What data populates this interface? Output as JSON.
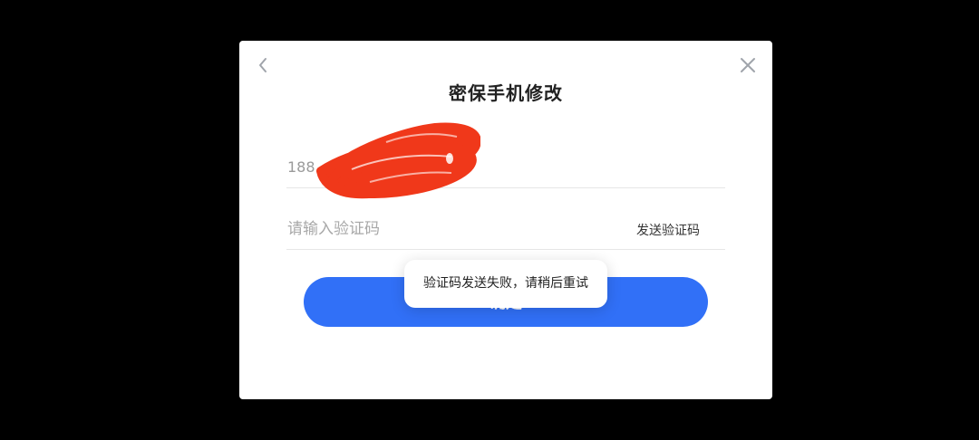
{
  "dialog": {
    "title": "密保手机修改",
    "back_icon": "chevron-left-icon",
    "close_icon": "close-icon"
  },
  "phone_field": {
    "value": "188"
  },
  "code_field": {
    "value": "",
    "placeholder": "请输入验证码",
    "send_code_label": "发送验证码"
  },
  "confirm_button": {
    "label": "确定"
  },
  "toast": {
    "message": "验证码发送失败，请稍后重试"
  },
  "colors": {
    "background": "#000000",
    "dialog": "#ffffff",
    "primary_button": "#3170f7",
    "redaction": "#f0381a",
    "placeholder": "#a8a8a8"
  }
}
